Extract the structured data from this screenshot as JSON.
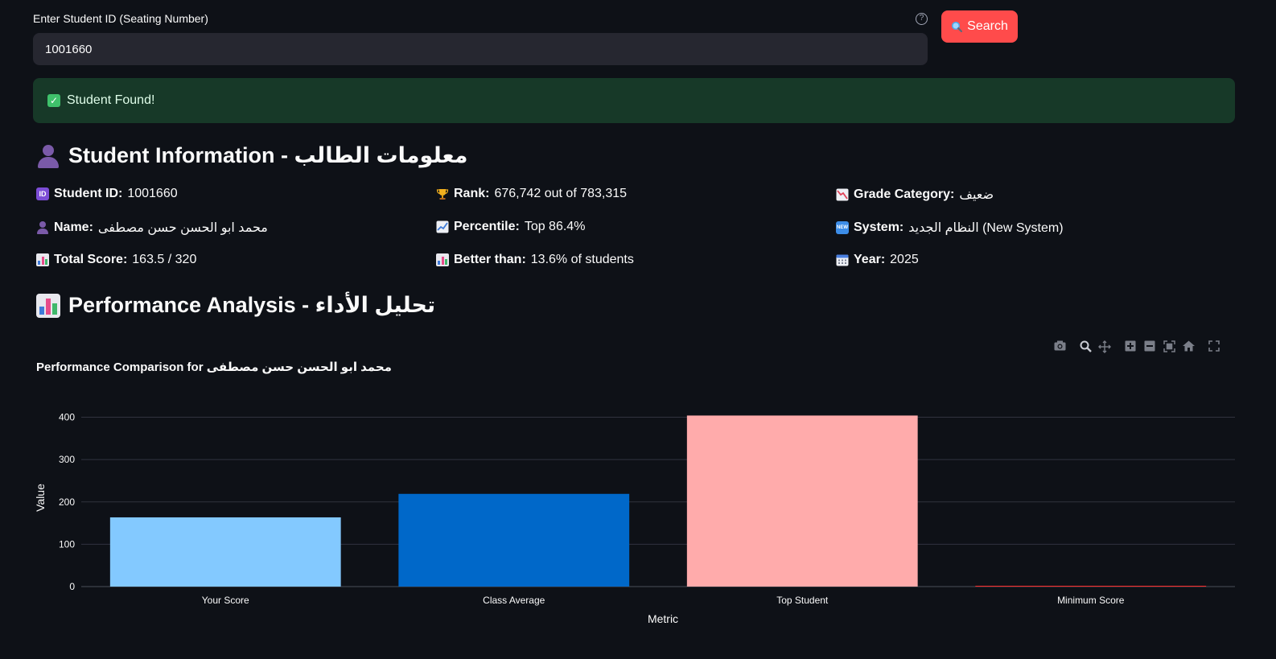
{
  "search": {
    "label": "Enter Student ID (Seating Number)",
    "value": "1001660",
    "help_icon": "?",
    "button_icon": "magnifier-icon",
    "button_label": "Search"
  },
  "alert": {
    "text": "Student Found!",
    "icon": "check-icon"
  },
  "student_info": {
    "heading": "Student Information - معلومات الطالب",
    "student_id": {
      "label": "Student ID:",
      "value": "1001660",
      "icon": "id-icon"
    },
    "name": {
      "label": "Name:",
      "value": "محمد ابو الحسن حسن مصطفى",
      "icon": "person-icon"
    },
    "total_score": {
      "label": "Total Score:",
      "value": "163.5 / 320",
      "icon": "bar-chart-icon"
    },
    "rank": {
      "label": "Rank:",
      "value": "676,742 out of 783,315",
      "icon": "trophy-icon"
    },
    "percentile": {
      "label": "Percentile:",
      "value": "Top 86.4%",
      "icon": "trend-up-icon"
    },
    "better_than": {
      "label": "Better than:",
      "value": "13.6% of students",
      "icon": "bar-chart-icon"
    },
    "grade_category": {
      "label": "Grade Category:",
      "value": "ضعيف",
      "icon": "trend-down-icon"
    },
    "system": {
      "label": "System:",
      "value": "النظام الجديد (New System)",
      "icon": "new-icon"
    },
    "year": {
      "label": "Year:",
      "value": "2025",
      "icon": "calendar-icon"
    }
  },
  "performance": {
    "heading": "Performance Analysis - تحليل الأداء"
  },
  "chart_data": {
    "type": "bar",
    "title": "Performance Comparison for محمد ابو الحسن حسن مصطفى",
    "xlabel": "Metric",
    "ylabel": "Value",
    "categories": [
      "Your Score",
      "Class Average",
      "Top Student",
      "Minimum Score"
    ],
    "values": [
      163.5,
      219,
      404,
      1
    ],
    "colors": [
      "#83c9ff",
      "#0068c9",
      "#ffabab",
      "#ff2b2b"
    ],
    "ylim": [
      0,
      420
    ],
    "yticks": [
      "0",
      "100",
      "200",
      "300",
      "400"
    ],
    "grid": true
  },
  "colors": {
    "background": "#0e1117",
    "accent": "#ff4b4b",
    "success_bg": "#173928"
  }
}
